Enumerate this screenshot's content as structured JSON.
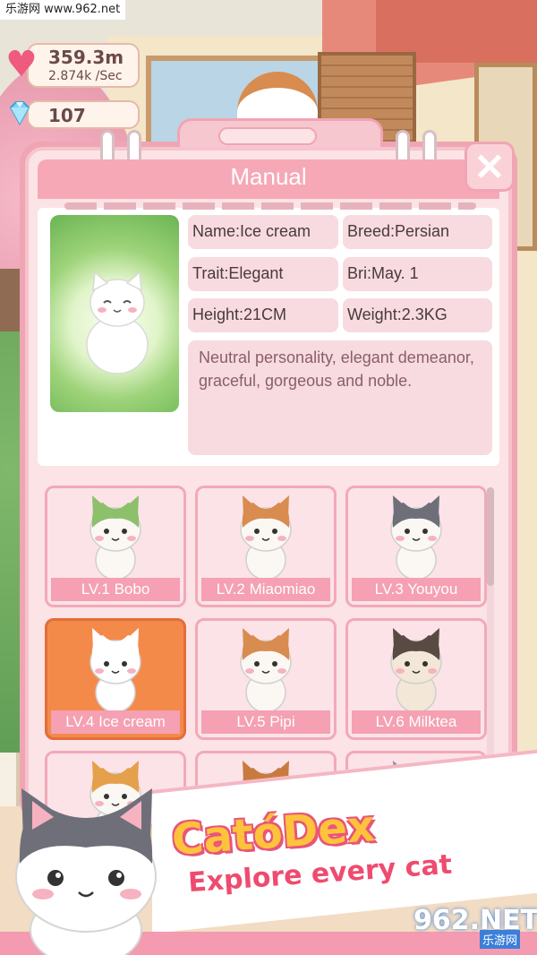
{
  "watermark": {
    "text": "乐游网 www.962.net"
  },
  "hud": {
    "love_total": "359.3m",
    "love_rate": "2.874k /Sec",
    "gems": "107"
  },
  "manual": {
    "title": "Manual",
    "close_label": "✕",
    "info": {
      "name": "Name:Ice cream",
      "breed": "Breed:Persian",
      "trait": "Trait:Elegant",
      "birthday": "Bri:May. 1",
      "height": "Height:21CM",
      "weight": "Weight:2.3KG",
      "description": "Neutral personality, elegant demeanor, graceful, gorgeous and noble."
    },
    "cats": [
      {
        "label": "LV.1 Bobo",
        "color": "#fbf8f4",
        "accent": "#8cc06b",
        "selected": false
      },
      {
        "label": "LV.2 Miaomiao",
        "color": "#fbf8f4",
        "accent": "#d88c4f",
        "selected": false
      },
      {
        "label": "LV.3 Youyou",
        "color": "#fbf8f4",
        "accent": "#6f6f7a",
        "selected": false
      },
      {
        "label": "LV.4 Ice cream",
        "color": "#ffffff",
        "accent": "#ffffff",
        "selected": true
      },
      {
        "label": "LV.5 Pipi",
        "color": "#fbf8f4",
        "accent": "#d88c4f",
        "selected": false
      },
      {
        "label": "LV.6 Milktea",
        "color": "#f3e7d7",
        "accent": "#5a4a44",
        "selected": false
      },
      {
        "label": "",
        "color": "#fbf8f4",
        "accent": "#e5a04b",
        "selected": false
      },
      {
        "label": "",
        "color": "#fbf8f4",
        "accent": "#c97a3f",
        "selected": false
      },
      {
        "label": "",
        "color": "#fbf8f4",
        "accent": "#8f8f97",
        "selected": false
      }
    ]
  },
  "promo": {
    "title": "CatóDex",
    "subtitle": "Explore every cat"
  },
  "logo": {
    "number": "962.NET",
    "cn": "乐游网"
  },
  "colors": {
    "panel_pink": "#fbe3e6",
    "title_pink": "#f6a8b6",
    "selected_orange": "#f48a4a",
    "label_pink": "#f5a0b3"
  }
}
